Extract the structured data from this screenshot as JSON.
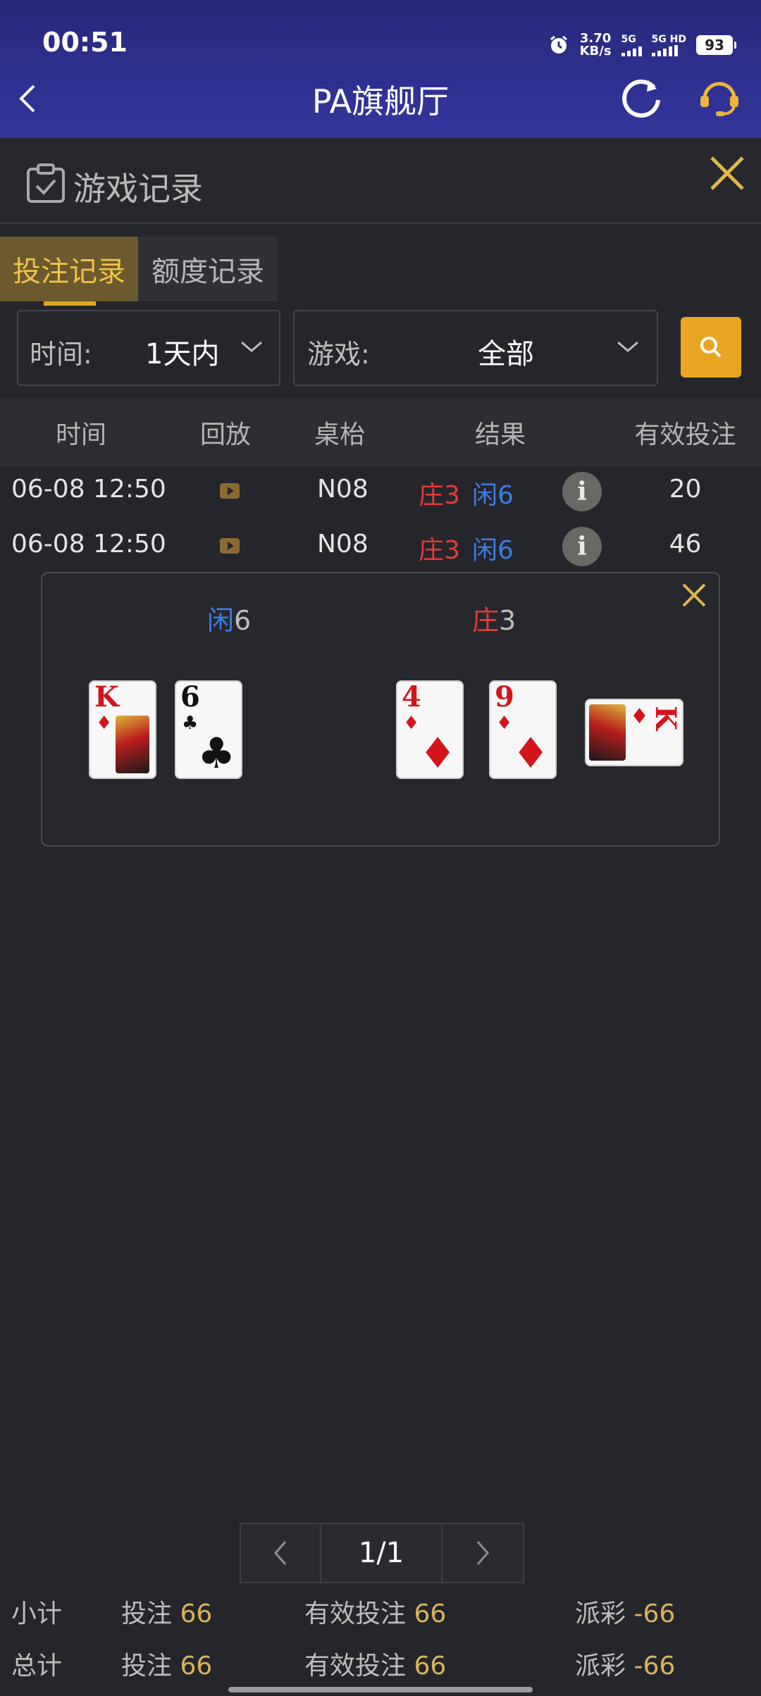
{
  "status_bar": {
    "time": "00:51",
    "net_speed_value": "3.70",
    "net_speed_unit": "KB/s",
    "sim1_label": "5G",
    "sim2_label": "5G HD",
    "battery": "93"
  },
  "header": {
    "title": "PA旗舰厅"
  },
  "subheader": {
    "title": "游戏记录"
  },
  "tabs": [
    {
      "label": "投注记录",
      "active": true
    },
    {
      "label": "额度记录",
      "active": false
    }
  ],
  "filters": {
    "time_label": "时间:",
    "time_value": "1天内",
    "game_label": "游戏:",
    "game_value": "全部"
  },
  "table": {
    "headers": [
      "时间",
      "回放",
      "桌枱",
      "结果",
      "有效投注"
    ],
    "rows": [
      {
        "time": "06-08 12:50",
        "table": "N08",
        "banker": "庄3",
        "player": "闲6",
        "valid_bet": "20"
      },
      {
        "time": "06-08 12:50",
        "table": "N08",
        "banker": "庄3",
        "player": "闲6",
        "valid_bet": "46"
      }
    ]
  },
  "detail_popup": {
    "player_label": "闲",
    "player_score": "6",
    "banker_label": "庄",
    "banker_score": "3",
    "player_cards": [
      {
        "rank": "K",
        "suit": "♦"
      },
      {
        "rank": "6",
        "suit": "♣"
      }
    ],
    "banker_cards": [
      {
        "rank": "4",
        "suit": "♦"
      },
      {
        "rank": "9",
        "suit": "♦"
      },
      {
        "rank": "K",
        "suit": "♦"
      }
    ]
  },
  "pagination": {
    "current": "1/1"
  },
  "summary": {
    "subtotal": {
      "label": "小计",
      "bet_label": "投注",
      "bet": "66",
      "valid_label": "有效投注",
      "valid": "66",
      "payout_label": "派彩",
      "payout": "-66"
    },
    "total": {
      "label": "总计",
      "bet_label": "投注",
      "bet": "66",
      "valid_label": "有效投注",
      "valid": "66",
      "payout_label": "派彩",
      "payout": "-66"
    }
  },
  "colors": {
    "accent_gold": "#e8a522",
    "banker_red": "#e53b35",
    "player_blue": "#3b7de6",
    "header_blue": "#2e3090"
  }
}
